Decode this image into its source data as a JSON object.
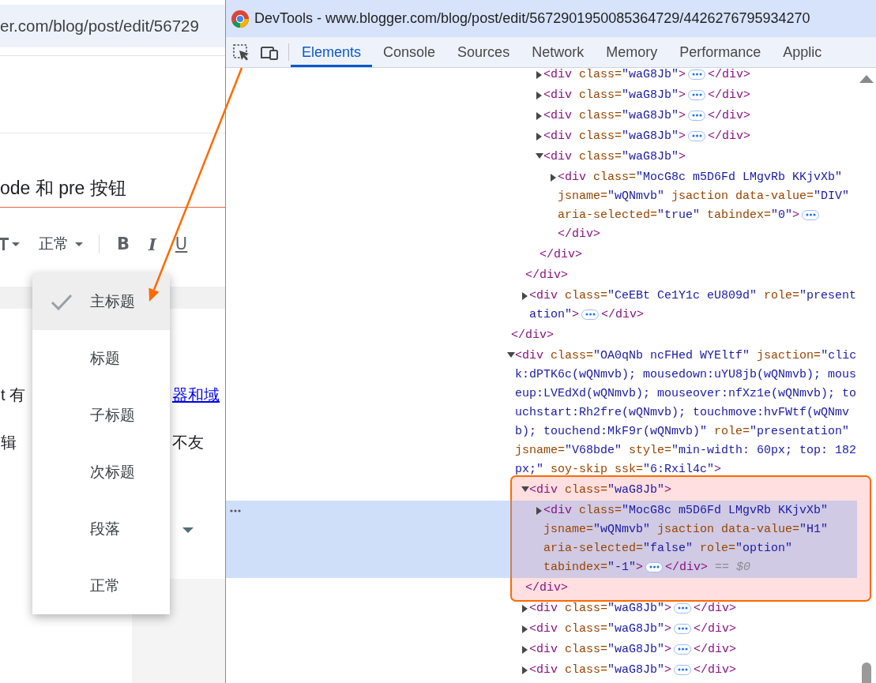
{
  "address_bar": {
    "url": "er.com/blog/post/edit/56729"
  },
  "editor": {
    "post_title": "ode 和 pre 按钮",
    "toolbar": {
      "paragraph_style": "正常",
      "format_buttons": [
        {
          "label": "B",
          "kind": "bold"
        },
        {
          "label": "I",
          "kind": "italic"
        },
        {
          "label": "U",
          "kind": "underline"
        }
      ]
    },
    "body_lines": [
      {
        "left": "t 有",
        "right": "器和域",
        "right_is_link": true
      },
      {
        "left": "辑",
        "right": "不友",
        "right_is_link": false
      }
    ]
  },
  "style_menu": {
    "items": [
      {
        "label": "主标题",
        "selected": true
      },
      {
        "label": "标题",
        "selected": false
      },
      {
        "label": "子标题",
        "selected": false
      },
      {
        "label": "次标题",
        "selected": false
      },
      {
        "label": "段落",
        "selected": false
      },
      {
        "label": "正常",
        "selected": false
      }
    ]
  },
  "devtools": {
    "title": "DevTools - www.blogger.com/blog/post/edit/5672901950085364729/4426276795934270",
    "tabs": [
      {
        "label": "Elements",
        "selected": true
      },
      {
        "label": "Console",
        "selected": false
      },
      {
        "label": "Sources",
        "selected": false
      },
      {
        "label": "Network",
        "selected": false
      },
      {
        "label": "Memory",
        "selected": false
      },
      {
        "label": "Performance",
        "selected": false
      },
      {
        "label": "Applic",
        "selected": false
      }
    ],
    "tree": [
      {
        "close_tag": "</div>",
        "children": [
          {
            "close_tag": "</div>",
            "children": [
              {
                "open_tag": [
                  "<div class=\"waG8Jb\">"
                ],
                "expanded": false,
                "selected": false,
                "highlighted": false,
                "close_tag": "</div>"
              },
              {
                "open_tag": [
                  "<div class=\"waG8Jb\">"
                ],
                "expanded": false,
                "selected": false,
                "highlighted": false,
                "close_tag": "</div>"
              },
              {
                "open_tag": [
                  "<div class=\"waG8Jb\">"
                ],
                "expanded": false,
                "selected": false,
                "highlighted": false,
                "close_tag": "</div>"
              },
              {
                "open_tag": [
                  "<div class=\"waG8Jb\">"
                ],
                "expanded": false,
                "selected": false,
                "highlighted": false,
                "close_tag": "</div>"
              },
              {
                "open_tag": [
                  "<div class=\"waG8Jb\">"
                ],
                "expanded": true,
                "selected": false,
                "highlighted": false,
                "close_tag": "</div>",
                "children": [
                  {
                    "open_tag": [
                      "<div class=\"MocG8c m5D6Fd LMgvRb KKjvXb\"",
                      "jsname=\"wQNmvb\" jsaction data-value=\"DIV\"",
                      "aria-selected=\"true\" tabindex=\"0\">"
                    ],
                    "expanded": false,
                    "selected": false,
                    "highlighted": false,
                    "close_tag": "</div>"
                  }
                ]
              }
            ]
          },
          {
            "open_tag": [
              "<div class=\"CeEBt Ce1Y1c eU809d\" role=\"present",
              "ation\">"
            ],
            "expanded": false,
            "selected": false,
            "highlighted": false,
            "close_tag": "</div>"
          }
        ]
      },
      {
        "open_tag": [
          "<div class=\"OA0qNb ncFHed WYEltf\" jsaction=\"clic",
          "k:dPTK6c(wQNmvb); mousedown:uYU8jb(wQNmvb); mous",
          "eup:LVEdXd(wQNmvb); mouseover:nfXz1e(wQNmvb); to",
          "uchstart:Rh2fre(wQNmvb); touchmove:hvFWtf(wQNmv",
          "b); touchend:MkF9r(wQNmvb)\" role=\"presentation\"",
          "jsname=\"V68bde\" style=\"min-width: 60px; top: 182",
          "px;\" soy-skip ssk=\"6:Rxil4c\">"
        ],
        "expanded": true,
        "selected": false,
        "highlighted": false,
        "children": [
          {
            "open_tag": [
              "<div class=\"waG8Jb\">"
            ],
            "expanded": true,
            "selected": false,
            "highlighted": true,
            "close_tag": "</div>",
            "children": [
              {
                "open_tag": [
                  "<div class=\"MocG8c m5D6Fd LMgvRb KKjvXb\"",
                  "jsname=\"wQNmvb\" jsaction data-value=\"H1\"",
                  "aria-selected=\"false\" role=\"option\"",
                  "tabindex=\"-1\">"
                ],
                "expanded": false,
                "selected": true,
                "highlighted": false,
                "close_tag": "</div>",
                "console_ref": "== $0"
              }
            ]
          },
          {
            "open_tag": [
              "<div class=\"waG8Jb\">"
            ],
            "expanded": false,
            "selected": false,
            "highlighted": false,
            "close_tag": "</div>"
          },
          {
            "open_tag": [
              "<div class=\"waG8Jb\">"
            ],
            "expanded": false,
            "selected": false,
            "highlighted": false,
            "close_tag": "</div>"
          },
          {
            "open_tag": [
              "<div class=\"waG8Jb\">"
            ],
            "expanded": false,
            "selected": false,
            "highlighted": false,
            "close_tag": "</div>"
          },
          {
            "open_tag": [
              "<div class=\"waG8Jb\">"
            ],
            "expanded": false,
            "selected": false,
            "highlighted": false,
            "close_tag": "</div>"
          }
        ]
      }
    ]
  }
}
